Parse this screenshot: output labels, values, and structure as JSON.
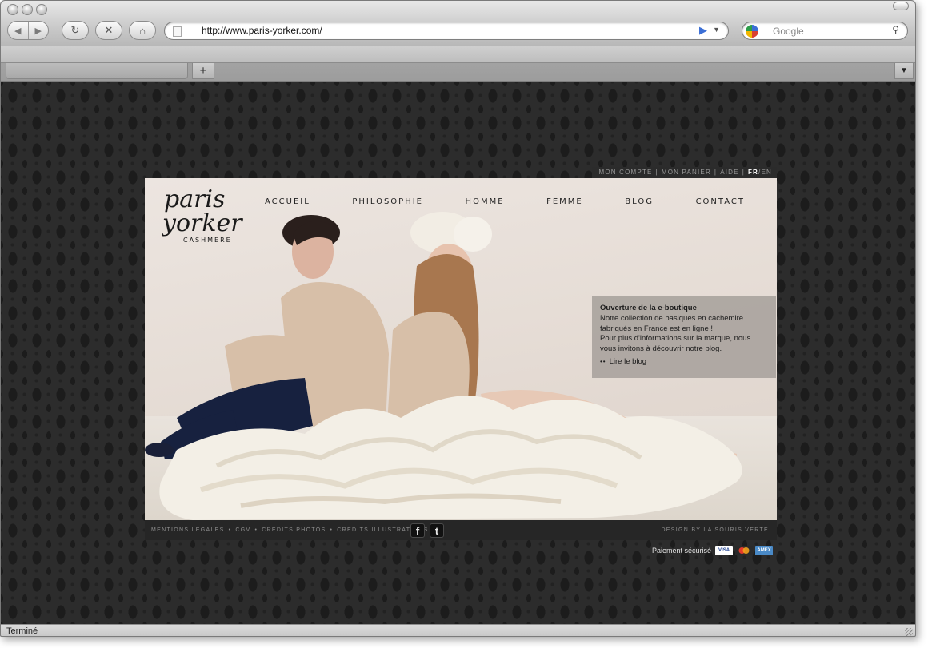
{
  "browser": {
    "url": "http://www.paris-yorker.com/",
    "search_placeholder": "Google",
    "new_tab_label": "+",
    "status_text": "Terminé",
    "icons": {
      "back": "back-arrow-icon",
      "forward": "forward-arrow-icon",
      "reload": "reload-icon",
      "stop": "stop-icon",
      "home": "home-icon",
      "go": "go-arrow-icon",
      "search": "magnifier-icon"
    }
  },
  "site": {
    "logo": {
      "line1": "paris",
      "line2": "yorker",
      "tagline": "CASHMERE"
    },
    "utility": {
      "account": "MON COMPTE",
      "cart": "MON PANIER",
      "help": "AIDE",
      "lang_fr": "FR",
      "lang_sep": "/",
      "lang_en": "EN"
    },
    "nav": [
      "ACCUEIL",
      "PHILOSOPHIE",
      "HOMME",
      "FEMME",
      "BLOG",
      "CONTACT"
    ],
    "announcement": {
      "title": "Ouverture de la e-boutique",
      "line1": "Notre collection de basiques en cachemire",
      "line2": "fabriqués en France est en ligne !",
      "line3": "Pour plus d'informations sur la marque, nous",
      "line4": "vous invitons à découvrir notre blog.",
      "link_bullet": "••",
      "link": "Lire le blog"
    },
    "footer": {
      "links": [
        "MENTIONS LEGALES",
        "CGV",
        "CREDITS PHOTOS",
        "CREDITS ILLUSTRATIONS"
      ],
      "separator": "•",
      "facebook": "f",
      "twitter": "t",
      "design_credit": "DESIGN BY LA SOURIS VERTE"
    },
    "payment": {
      "label": "Paiement sécurisé",
      "cards": [
        {
          "name": "visa-card-icon",
          "text": "VISA",
          "bg": "#ffffff",
          "fg": "#1a3d8f"
        },
        {
          "name": "mastercard-icon",
          "text": "",
          "bg": "#2a2a2a",
          "fg": "#ffffff"
        },
        {
          "name": "amex-card-icon",
          "text": "AMEX",
          "bg": "#4a8ac7",
          "fg": "#ffffff"
        }
      ]
    }
  }
}
